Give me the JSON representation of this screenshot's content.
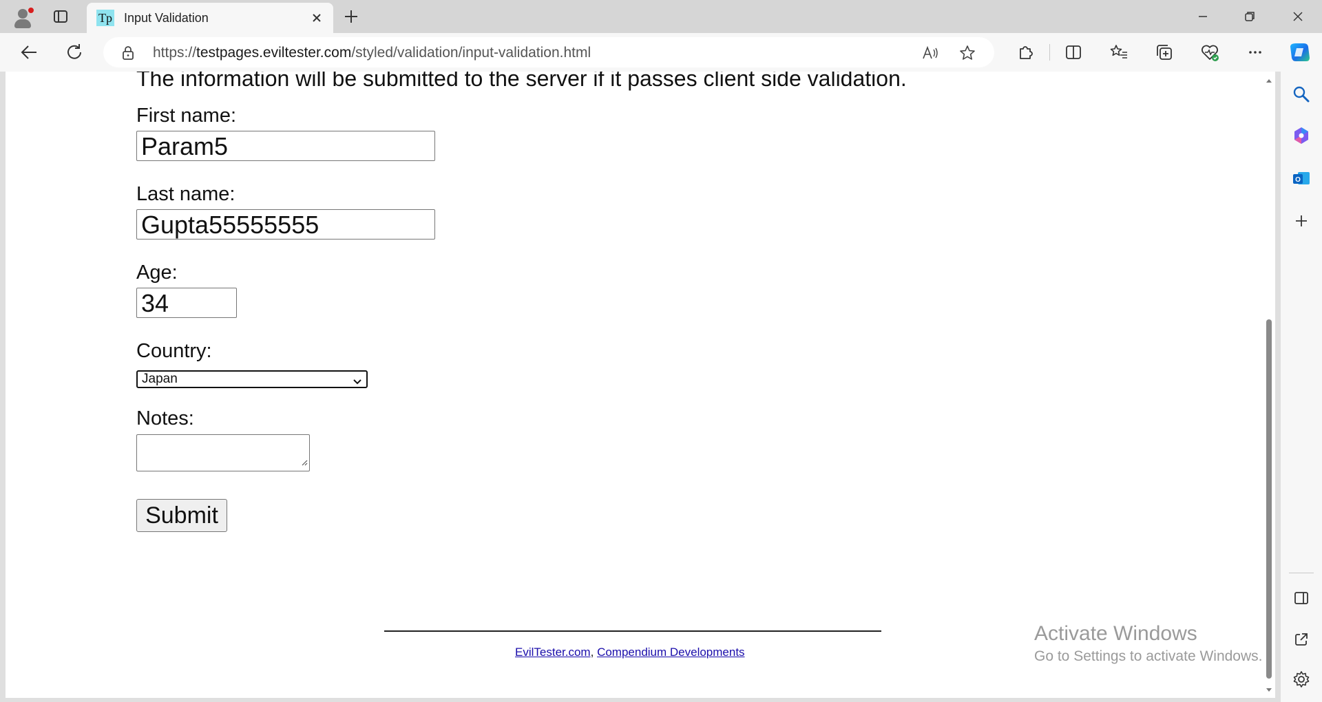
{
  "browser": {
    "tab": {
      "favicon_text": "Tp",
      "title": "Input Validation"
    },
    "address": {
      "scheme": "https://",
      "host": "testpages.eviltester.com",
      "path": "/styled/validation/input-validation.html"
    },
    "read_aloud_label": "A̅"
  },
  "page": {
    "intro_text": "The information will be submitted to the server if it passes client side validation.",
    "form": {
      "first_name": {
        "label": "First name:",
        "value": "Param5"
      },
      "last_name": {
        "label": "Last name:",
        "value": "Gupta55555555"
      },
      "age": {
        "label": "Age:",
        "value": "34"
      },
      "country": {
        "label": "Country:",
        "selected": "Japan"
      },
      "notes": {
        "label": "Notes:",
        "value": ""
      },
      "submit_label": "Submit"
    },
    "footer": {
      "link1": "EvilTester.com",
      "separator": ",",
      "link2": "Compendium Developments"
    }
  },
  "os_watermark": {
    "line1": "Activate Windows",
    "line2": "Go to Settings to activate Windows."
  },
  "colors": {
    "accent_link": "#1a0dab",
    "favicon_bg": "#8fe3ef",
    "profile_badge": "#d81e1e"
  }
}
